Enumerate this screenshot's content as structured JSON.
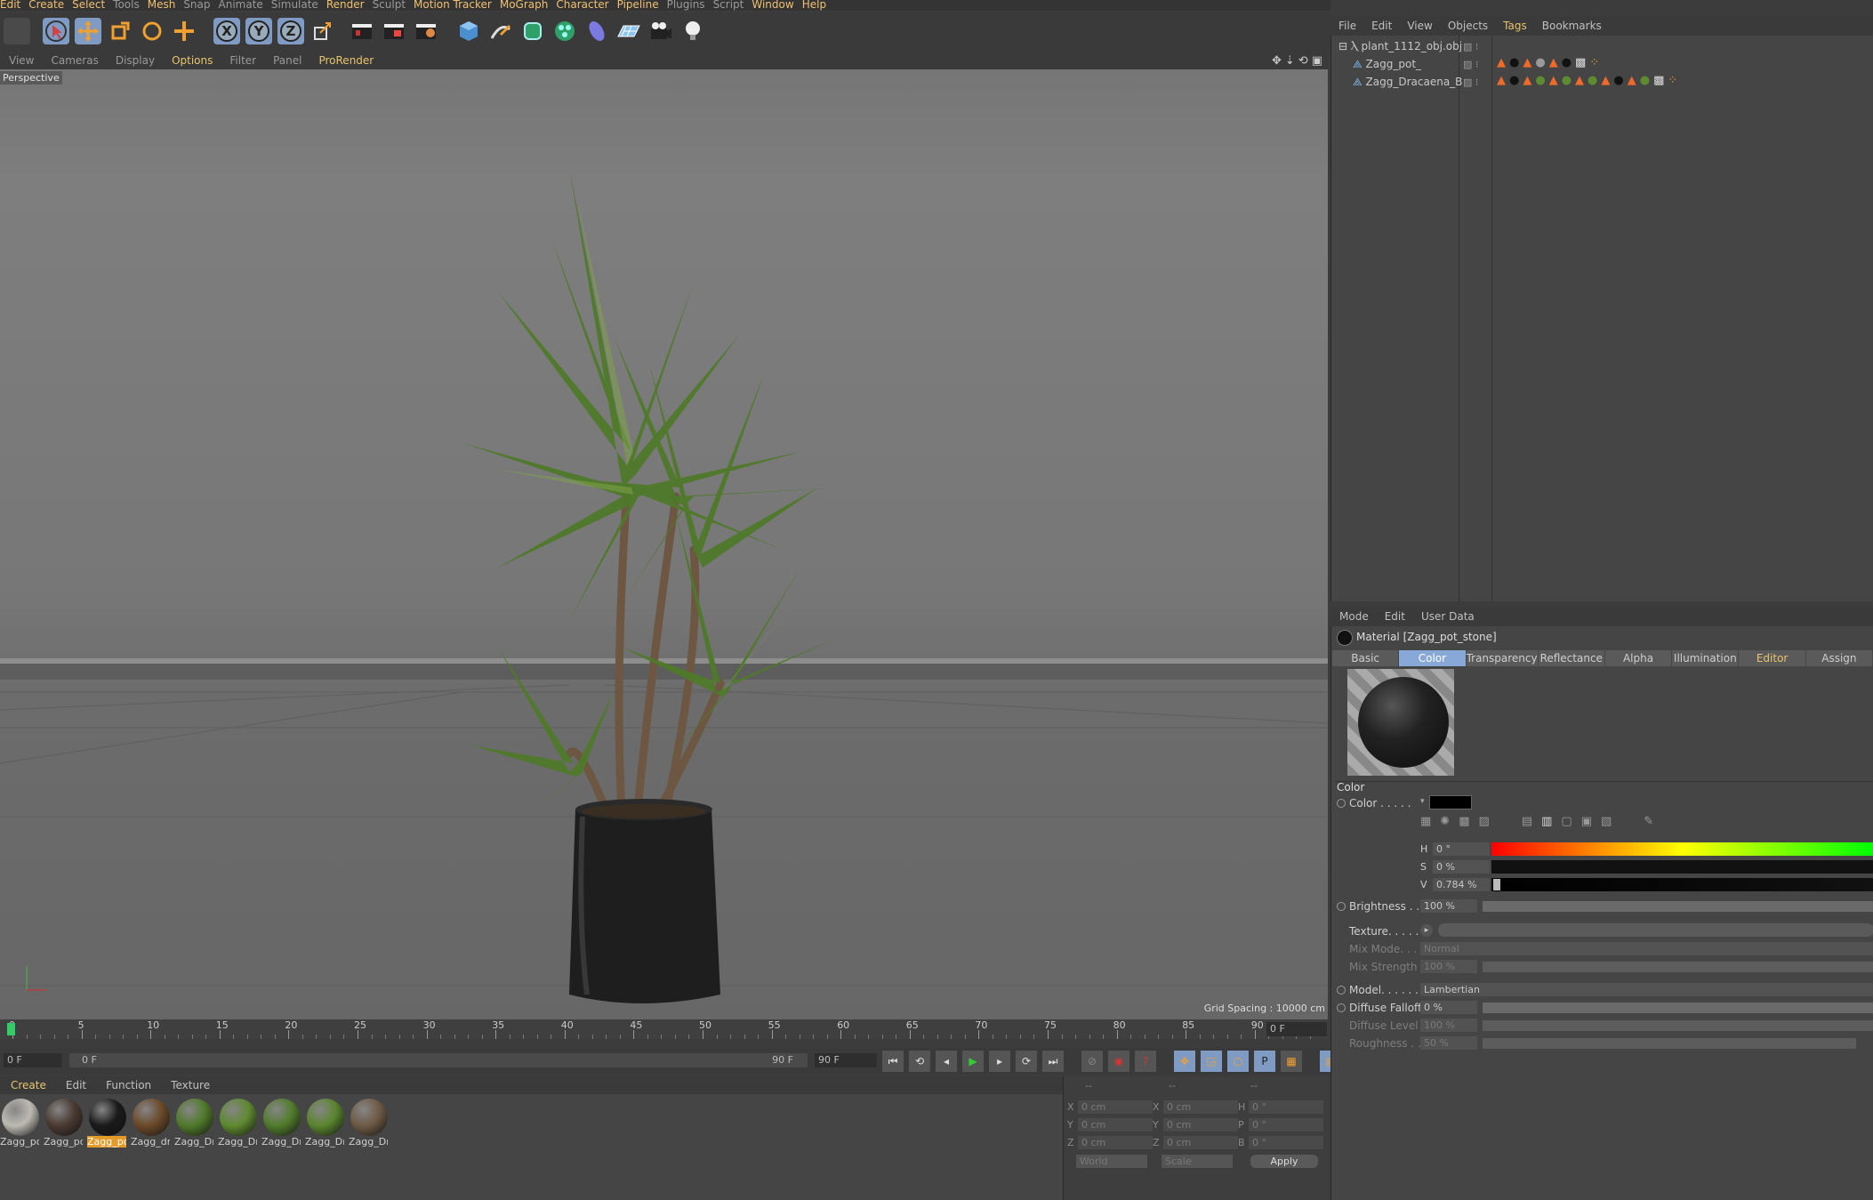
{
  "menubar": [
    "Edit",
    "Create",
    "Select",
    "Tools",
    "Mesh",
    "Snap",
    "Animate",
    "Simulate",
    "Render",
    "Sculpt",
    "Motion Tracker",
    "MoGraph",
    "Character",
    "Pipeline",
    "Plugins",
    "Script",
    "Window",
    "Help"
  ],
  "viewport": {
    "menu": [
      "View",
      "Cameras",
      "Display",
      "Options",
      "Filter",
      "Panel",
      "ProRender"
    ],
    "camera_label": "Perspective",
    "grid_spacing": "Grid Spacing : 10000 cm"
  },
  "timeline": {
    "ticks": [
      "0",
      "5",
      "10",
      "15",
      "20",
      "25",
      "30",
      "35",
      "40",
      "45",
      "50",
      "55",
      "60",
      "65",
      "70",
      "75",
      "80",
      "85",
      "90"
    ],
    "current_frame": "0 F",
    "start": "0 F",
    "range_start": "0 F",
    "range_end": "90 F",
    "end": "90 F",
    "end_frame_field": "0 F"
  },
  "material_manager": {
    "menu": [
      "Create",
      "Edit",
      "Function",
      "Texture"
    ],
    "materials": [
      {
        "label": "Zagg_po",
        "color": "#bdbab2"
      },
      {
        "label": "Zagg_po",
        "color": "#4a3a32"
      },
      {
        "label": "Zagg_po",
        "color": "#1a1a1a",
        "selected": true
      },
      {
        "label": "Zagg_dr",
        "color": "#6b4a2a"
      },
      {
        "label": "Zagg_Dr",
        "color": "#4f7a2a"
      },
      {
        "label": "Zagg_Dr",
        "color": "#5e8a30"
      },
      {
        "label": "Zagg_Dr",
        "color": "#517c2c"
      },
      {
        "label": "Zagg_Dr",
        "color": "#5a852e"
      },
      {
        "label": "Zagg_Dr",
        "color": "#6e5a45"
      }
    ]
  },
  "coord_manager": {
    "header": [
      "--",
      "--",
      "--"
    ],
    "rows": [
      {
        "a": "X",
        "av": "0 cm",
        "b": "X",
        "bv": "0 cm",
        "c": "H",
        "cv": "0 °"
      },
      {
        "a": "Y",
        "av": "0 cm",
        "b": "Y",
        "bv": "0 cm",
        "c": "P",
        "cv": "0 °"
      },
      {
        "a": "Z",
        "av": "0 cm",
        "b": "Z",
        "bv": "0 cm",
        "c": "B",
        "cv": "0 °"
      }
    ],
    "space": "World",
    "mode": "Scale",
    "apply": "Apply"
  },
  "object_manager": {
    "menu": [
      "File",
      "Edit",
      "View",
      "Objects",
      "Tags",
      "Bookmarks"
    ],
    "objects": [
      "plant_1112_obj.obj",
      "Zagg_pot_",
      "Zagg_Dracaena_B"
    ]
  },
  "attribute_manager": {
    "menu": [
      "Mode",
      "Edit",
      "User Data"
    ],
    "title": "Material [Zagg_pot_stone]",
    "tabs": [
      "Basic",
      "Color",
      "Transparency",
      "Reflectance",
      "Alpha",
      "Illumination",
      "Editor",
      "Assign"
    ],
    "section": "Color",
    "color_label": "Color . . . . .",
    "h_label": "H",
    "h_value": "0 °",
    "s_label": "S",
    "s_value": "0 %",
    "v_label": "V",
    "v_value": "0.784 %",
    "brightness_label": "Brightness . . .",
    "brightness_value": "100 %",
    "texture_label": "Texture. . . . . .",
    "mixmode_label": "Mix Mode. . . .",
    "mixmode_value": "Normal",
    "mixstrength_label": "Mix Strength . .",
    "mixstrength_value": "100 %",
    "model_label": "Model. . . . . . .",
    "model_value": "Lambertian",
    "falloff_label": "Diffuse Falloff",
    "falloff_value": "0 %",
    "level_label": "Diffuse Level",
    "level_value": "100 %",
    "roughness_label": "Roughness . .",
    "roughness_value": "50 %"
  }
}
